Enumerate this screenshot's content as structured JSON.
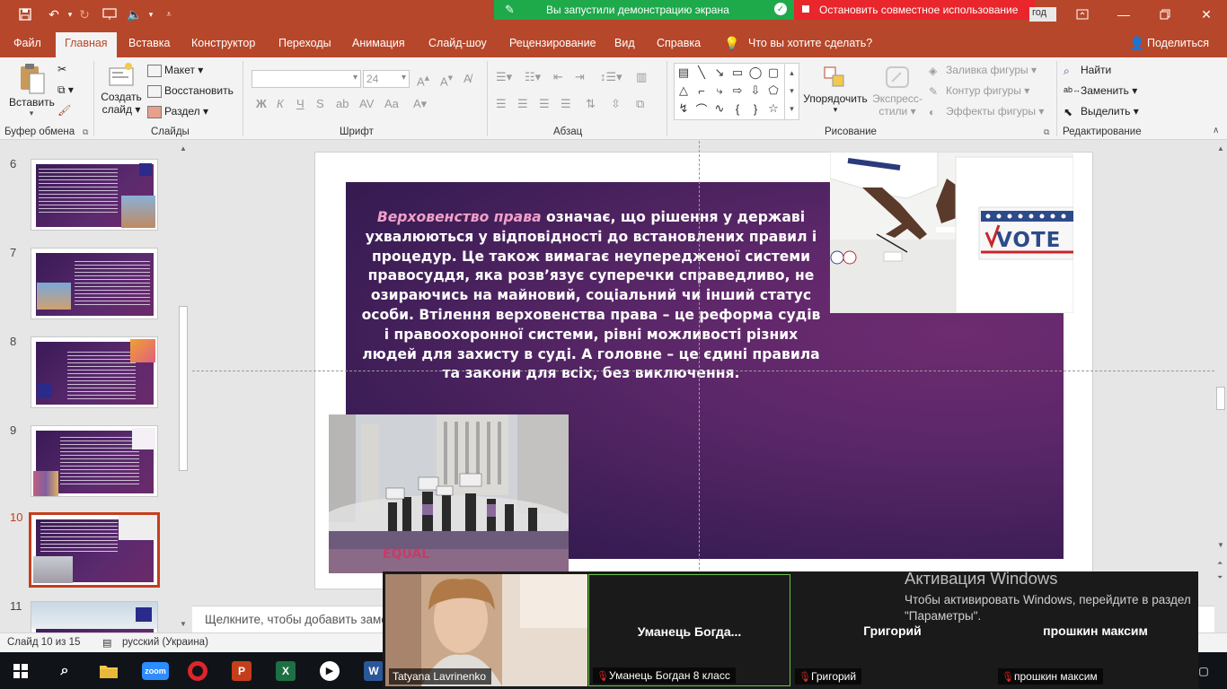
{
  "screen_banner": {
    "sharing_label": "Вы запустили демонстрацию экрана",
    "stop_label": "Остановить совместное использование",
    "login_partial": "год"
  },
  "tabs": [
    "Файл",
    "Главная",
    "Вставка",
    "Конструктор",
    "Переходы",
    "Анимация",
    "Слайд-шоу",
    "Рецензирование",
    "Вид",
    "Справка"
  ],
  "active_tab": "Главная",
  "tell_me": "Что вы хотите сделать?",
  "share": "Поделиться",
  "ribbon": {
    "clipboard": {
      "paste": "Вставить",
      "label": "Буфер обмена"
    },
    "slides": {
      "new_slide_1": "Создать",
      "new_slide_2": "слайд",
      "layout": "Макет",
      "reset": "Восстановить",
      "section": "Раздел",
      "label": "Слайды"
    },
    "font": {
      "size": "24",
      "label": "Шрифт",
      "bold": "Ж",
      "italic": "К",
      "underline": "Ч",
      "strike": "S"
    },
    "paragraph": {
      "label": "Абзац"
    },
    "drawing": {
      "arrange_1": "Упорядочить",
      "quick_styles_1": "Экспресс-",
      "quick_styles_2": "стили",
      "shape_fill": "Заливка фигуры",
      "shape_outline": "Контур фигуры",
      "shape_effects": "Эффекты фигуры",
      "label": "Рисование"
    },
    "editing": {
      "find": "Найти",
      "replace": "Заменить",
      "select": "Выделить",
      "label": "Редактирование"
    }
  },
  "thumbnails": [
    {
      "num": "6"
    },
    {
      "num": "7"
    },
    {
      "num": "8"
    },
    {
      "num": "9"
    },
    {
      "num": "10"
    },
    {
      "num": "11"
    }
  ],
  "slide": {
    "highlight": "Верховенство права",
    "body": " означає, що рішення у державі ухвалюються у відповідності до встановлених правил і процедур. Це також вимагає неупередженої системи правосуддя, яка розв’язує суперечки справедливо, не озираючись на майновий, соціальний чи інший статус особи. Втілення верховенства права – це реформа судів і правоохоронної системи, рівні можливості різних людей для захисту в суді. А головне – це єдині правила та закони для всіх, без виключення.",
    "vote_sign": "VOTE"
  },
  "notes_placeholder": "Щелкните, чтобы добавить заметки",
  "status": {
    "slide_info": "Слайд 10 из 15",
    "language": "русский (Украина)"
  },
  "zoom": {
    "tiles": [
      {
        "name": "",
        "tag": "Tatyana Lavrinenko"
      },
      {
        "name": "Уманець  Богда...",
        "tag": "Уманець Богдан 8 класс"
      },
      {
        "name": "Григорий",
        "tag": "Григорий"
      },
      {
        "name": "прошкин максим",
        "tag": "прошкин максим"
      }
    ]
  },
  "windows_activation": {
    "title": "Активация Windows",
    "subtitle": "Чтобы активировать Windows, перейдите в раздел \"Параметры\"."
  },
  "taskbar": {
    "zoom_label": "zoom"
  },
  "colors": {
    "accent": "#b7472a",
    "sharing_green": "#1ea94b",
    "stop_red": "#e8262b",
    "slide_purple": "#5b2768"
  }
}
